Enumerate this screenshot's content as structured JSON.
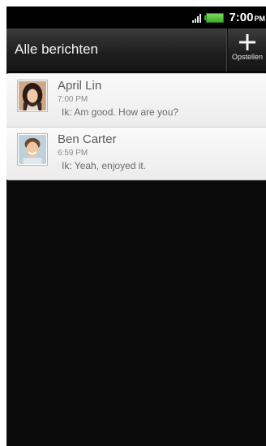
{
  "status_bar": {
    "time": "7:00",
    "ampm": "PM",
    "signal_icon": "signal-icon",
    "battery_icon": "battery-icon"
  },
  "header": {
    "title": "Alle berichten",
    "compose_label": "Opstellen",
    "compose_icon": "plus-icon"
  },
  "threads": [
    {
      "name": "April Lin",
      "time": "7:00 PM",
      "snippet": "Ik:  Am good. How are you?",
      "avatar": "avatar-april"
    },
    {
      "name": "Ben Carter",
      "time": "6:59 PM",
      "snippet": "Ik:  Yeah, enjoyed it.",
      "avatar": "avatar-ben"
    }
  ],
  "colors": {
    "background": "#0b0b0b",
    "list_background": "#f2f2f2",
    "battery": "#4cc334"
  }
}
